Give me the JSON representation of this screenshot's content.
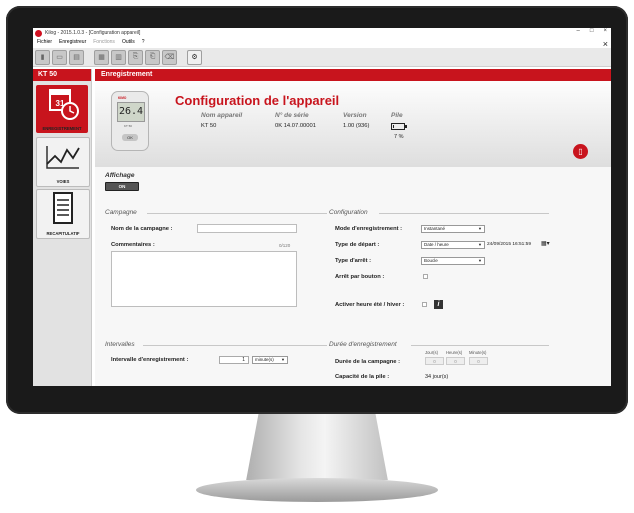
{
  "window": {
    "title": "Kilog - 2015.1.0.3 - [Configuration appareil]",
    "controls": [
      "–",
      "□",
      "×"
    ],
    "close_label": "×"
  },
  "menu": {
    "items": [
      "Fichier",
      "Enregistreur",
      "Fonctions",
      "Outils",
      "?"
    ]
  },
  "sidebar": {
    "header": "KT 50",
    "items": [
      {
        "label": "ENREGISTREMENT",
        "calendar_day": "31"
      },
      {
        "label": "VOIES"
      },
      {
        "label": "RECAPITULATIF"
      }
    ]
  },
  "main": {
    "header": "Enregistrement",
    "title": "Configuration de l'appareil"
  },
  "device": {
    "brand": "KIMO",
    "lcd": "26.4",
    "model": "KT 50",
    "button": "OK",
    "name_header": "Nom appareil",
    "name_value": "KT 50",
    "serial_header": "N° de série",
    "serial_value": "0K 14.07.00001",
    "version_header": "Version",
    "version_value": "1.00 (936)",
    "battery_header": "Pile",
    "battery_value": "7 %",
    "battery_level": 0.07
  },
  "display": {
    "label": "Affichage",
    "toggle": "ON"
  },
  "campaign": {
    "section": "Campagne",
    "name_label": "Nom de la campagne :",
    "name_value": "",
    "comments_label": "Commentaires :",
    "comments_counter": "0/120"
  },
  "configuration": {
    "section": "Configuration",
    "mode_label": "Mode d'enregistrement :",
    "mode_value": "Instantané",
    "start_label": "Type de départ :",
    "start_value": "Date / heure",
    "start_datetime": "24/09/2015 16:51:59",
    "stop_label": "Type d'arrêt :",
    "stop_value": "Boucle",
    "button_stop_label": "Arrêt par bouton :",
    "dst_label": "Activer heure été / hiver :",
    "info_label": "i"
  },
  "intervals": {
    "section": "Intervalles",
    "interval_label": "Intervalle d'enregistrement :",
    "interval_value": "1",
    "interval_unit": "minute(s)"
  },
  "duration": {
    "section": "Durée d'enregistrement",
    "units": [
      "Jour(s)",
      "Heure(s)",
      "Minute(s)"
    ],
    "campaign_label": "Durée de la campagne :",
    "values": [
      "0",
      "0",
      "0"
    ],
    "battery_label": "Capacité de la pile :",
    "battery_value": "34 jour(s)"
  },
  "colors": {
    "accent": "#c8141d",
    "bezel": "#1a1a1a"
  }
}
